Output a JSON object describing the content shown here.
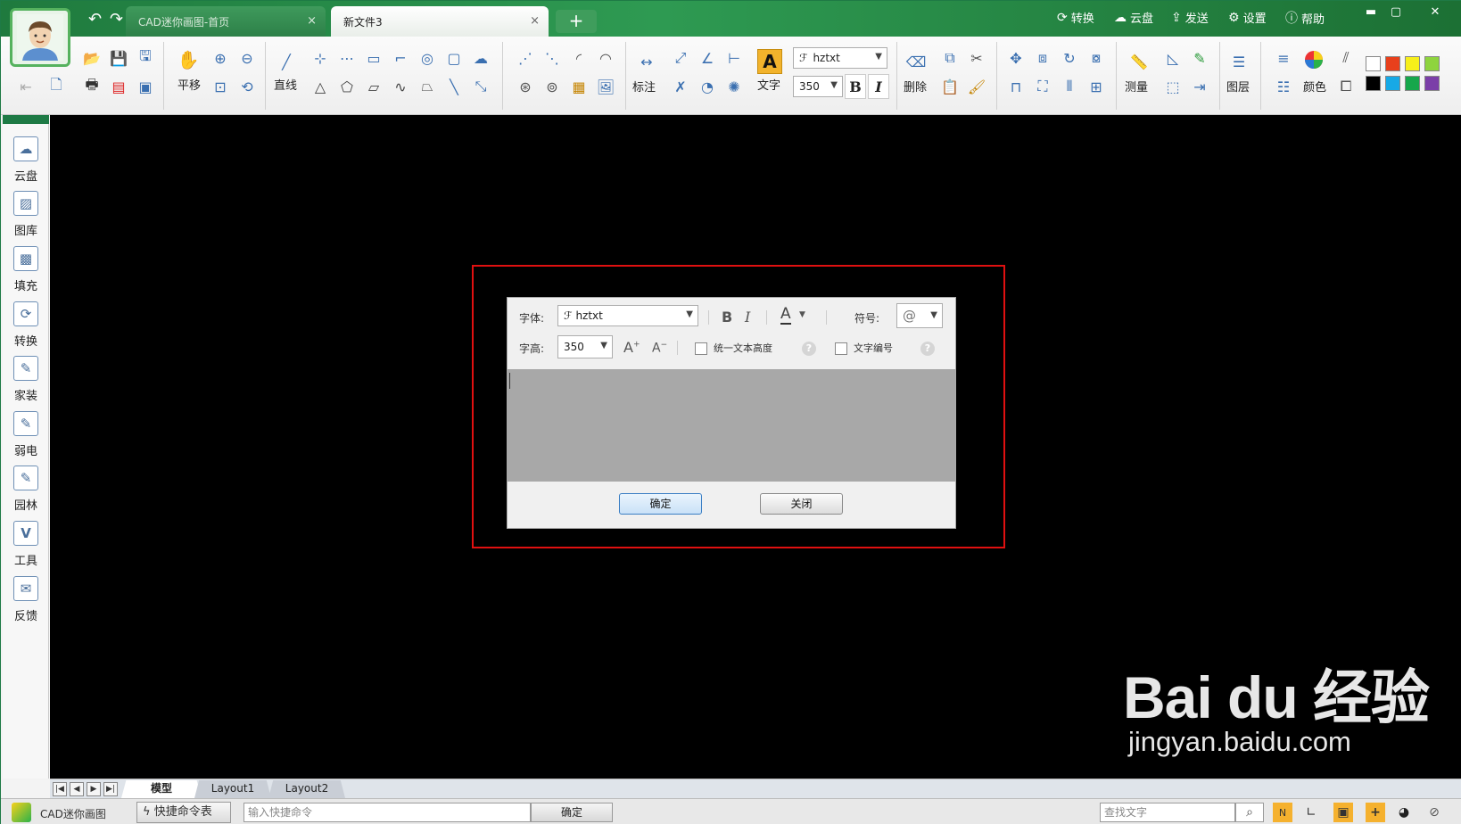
{
  "window": {
    "tabs": [
      {
        "label": "CAD迷你画图-首页",
        "close": "×"
      },
      {
        "label": "新文件3",
        "close": "×"
      }
    ],
    "add_tab": "+",
    "menu": [
      {
        "label": "转换",
        "icon": "refresh-icon"
      },
      {
        "label": "云盘",
        "icon": "cloud-icon"
      },
      {
        "label": "发送",
        "icon": "send-icon"
      },
      {
        "label": "设置",
        "icon": "gear-icon"
      },
      {
        "label": "帮助",
        "icon": "help-icon"
      }
    ],
    "controls": {
      "minimize": "▬",
      "maximize": "▢",
      "close": "✕"
    }
  },
  "ribbon": {
    "pan": "平移",
    "line": "直线",
    "dimension": "标注",
    "text": "文字",
    "text_icon": "A",
    "font": "hztxt",
    "height": "350",
    "bold": "B",
    "italic": "I",
    "delete": "删除",
    "measure": "测量",
    "layer": "图层",
    "color": "颜色",
    "swatches": [
      "#ffffff",
      "#e8401c",
      "#f7ef1a",
      "#8ed43e",
      "#000000",
      "#17a9e6",
      "#16a74b",
      "#7b3fa8"
    ]
  },
  "sidebar": [
    {
      "label": "云盘",
      "icon": "cloud-icon"
    },
    {
      "label": "图库",
      "icon": "image-icon"
    },
    {
      "label": "填充",
      "icon": "hatch-icon"
    },
    {
      "label": "转换",
      "icon": "refresh-icon"
    },
    {
      "label": "家装",
      "icon": "home-pen-icon"
    },
    {
      "label": "弱电",
      "icon": "electric-pen-icon"
    },
    {
      "label": "园林",
      "icon": "garden-pen-icon"
    },
    {
      "label": "工具",
      "icon": "tool-icon"
    },
    {
      "label": "反馈",
      "icon": "mail-icon"
    }
  ],
  "dialog": {
    "font_label": "字体:",
    "font_value": "hztxt",
    "bold": "B",
    "italic": "I",
    "color_glyph": "A",
    "symbol_label": "符号:",
    "symbol_value": "@",
    "height_label": "字高:",
    "height_value": "350",
    "grow_glyph": "A",
    "shrink_glyph": "A",
    "uniform_height_label": "统一文本高度",
    "uniform_height_checked": false,
    "numbering_label": "文字编号",
    "numbering_checked": false,
    "help_glyph": "?",
    "text_content": "",
    "ok": "确定",
    "close": "关闭"
  },
  "layout_tabs": [
    "模型",
    "Layout1",
    "Layout2"
  ],
  "layout_nav": [
    "|◀",
    "◀",
    "▶",
    "▶|"
  ],
  "status": {
    "app_name": "CAD迷你画图",
    "shortcut_table": "快捷命令表",
    "command_placeholder": "输入快捷命令",
    "confirm": "确定",
    "search_placeholder": "查找文字"
  },
  "watermark": {
    "main": "Bai  du 经验",
    "sub": "jingyan.baidu.com"
  }
}
